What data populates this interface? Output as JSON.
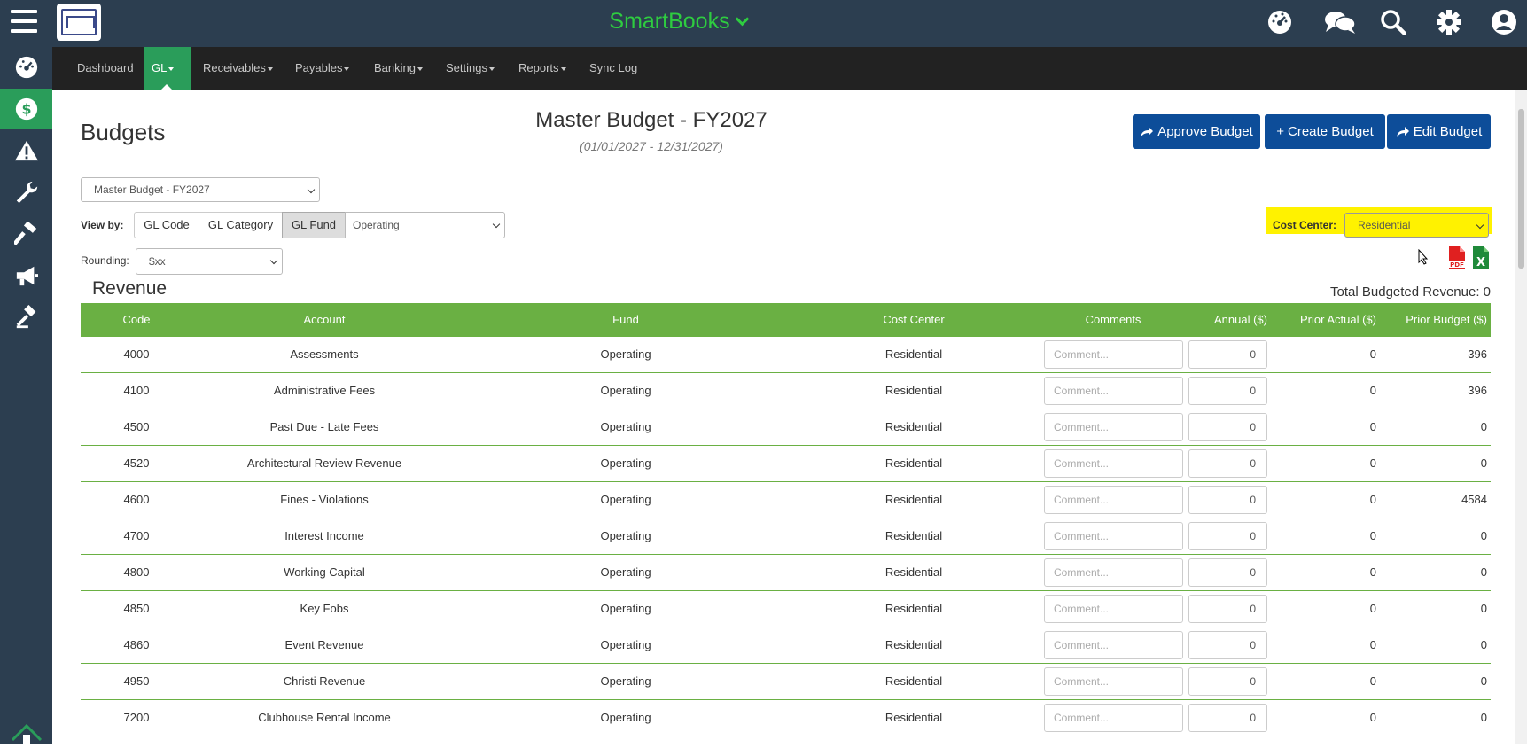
{
  "app": {
    "title": "SmartBooks"
  },
  "top_icons": [
    "dashboard-gauge-icon",
    "chat-icon",
    "search-icon",
    "gear-icon",
    "user-icon"
  ],
  "sidebar": {
    "items": [
      {
        "name": "dashboard-gauge-icon",
        "active": false
      },
      {
        "name": "dollar-icon",
        "active": true
      },
      {
        "name": "warning-icon",
        "active": false
      },
      {
        "name": "wrench-icon",
        "active": false
      },
      {
        "name": "hammer-icon",
        "active": false
      },
      {
        "name": "megaphone-icon",
        "active": false
      },
      {
        "name": "gavel-icon",
        "active": false
      }
    ]
  },
  "nav": {
    "dashboard": "Dashboard",
    "gl": "GL",
    "receivables": "Receivables",
    "payables": "Payables",
    "banking": "Banking",
    "settings": "Settings",
    "reports": "Reports",
    "sync_log": "Sync Log"
  },
  "page": {
    "title": "Budgets",
    "budget_title": "Master Budget - FY2027",
    "budget_dates": "(01/01/2027 - 12/31/2027)"
  },
  "buttons": {
    "approve": "Approve Budget",
    "create": "Create Budget",
    "edit": "Edit Budget"
  },
  "controls": {
    "budget_select": "Master Budget - FY2027",
    "view_by_label": "View by:",
    "view_gl_code": "GL Code",
    "view_gl_category": "GL Category",
    "view_gl_fund": "GL Fund",
    "fund_select": "Operating",
    "rounding_label": "Rounding:",
    "rounding_select": "$xx",
    "cost_center_label": "Cost Center:",
    "cost_center_select": "Residential"
  },
  "colors": {
    "accent_green": "#6ab043",
    "brand_blue": "#0d4d99",
    "sidebar": "#2c3e50",
    "highlight": "#fff200"
  },
  "revenue": {
    "title": "Revenue",
    "total": "Total Budgeted Revenue: 0",
    "headers": {
      "code": "Code",
      "account": "Account",
      "fund": "Fund",
      "cost_center": "Cost Center",
      "comments": "Comments",
      "annual": "Annual ($)",
      "prior_actual": "Prior Actual ($)",
      "prior_budget": "Prior Budget ($)"
    },
    "comment_placeholder": "Comment...",
    "rows": [
      {
        "code": "4000",
        "account": "Assessments",
        "fund": "Operating",
        "cost_center": "Residential",
        "annual": "0",
        "prior_actual": "0",
        "prior_budget": "396"
      },
      {
        "code": "4100",
        "account": "Administrative Fees",
        "fund": "Operating",
        "cost_center": "Residential",
        "annual": "0",
        "prior_actual": "0",
        "prior_budget": "396"
      },
      {
        "code": "4500",
        "account": "Past Due - Late Fees",
        "fund": "Operating",
        "cost_center": "Residential",
        "annual": "0",
        "prior_actual": "0",
        "prior_budget": "0"
      },
      {
        "code": "4520",
        "account": "Architectural Review Revenue",
        "fund": "Operating",
        "cost_center": "Residential",
        "annual": "0",
        "prior_actual": "0",
        "prior_budget": "0"
      },
      {
        "code": "4600",
        "account": "Fines - Violations",
        "fund": "Operating",
        "cost_center": "Residential",
        "annual": "0",
        "prior_actual": "0",
        "prior_budget": "4584"
      },
      {
        "code": "4700",
        "account": "Interest Income",
        "fund": "Operating",
        "cost_center": "Residential",
        "annual": "0",
        "prior_actual": "0",
        "prior_budget": "0"
      },
      {
        "code": "4800",
        "account": "Working Capital",
        "fund": "Operating",
        "cost_center": "Residential",
        "annual": "0",
        "prior_actual": "0",
        "prior_budget": "0"
      },
      {
        "code": "4850",
        "account": "Key Fobs",
        "fund": "Operating",
        "cost_center": "Residential",
        "annual": "0",
        "prior_actual": "0",
        "prior_budget": "0"
      },
      {
        "code": "4860",
        "account": "Event Revenue",
        "fund": "Operating",
        "cost_center": "Residential",
        "annual": "0",
        "prior_actual": "0",
        "prior_budget": "0"
      },
      {
        "code": "4950",
        "account": "Christi Revenue",
        "fund": "Operating",
        "cost_center": "Residential",
        "annual": "0",
        "prior_actual": "0",
        "prior_budget": "0"
      },
      {
        "code": "7200",
        "account": "Clubhouse Rental Income",
        "fund": "Operating",
        "cost_center": "Residential",
        "annual": "0",
        "prior_actual": "0",
        "prior_budget": "0"
      }
    ]
  }
}
